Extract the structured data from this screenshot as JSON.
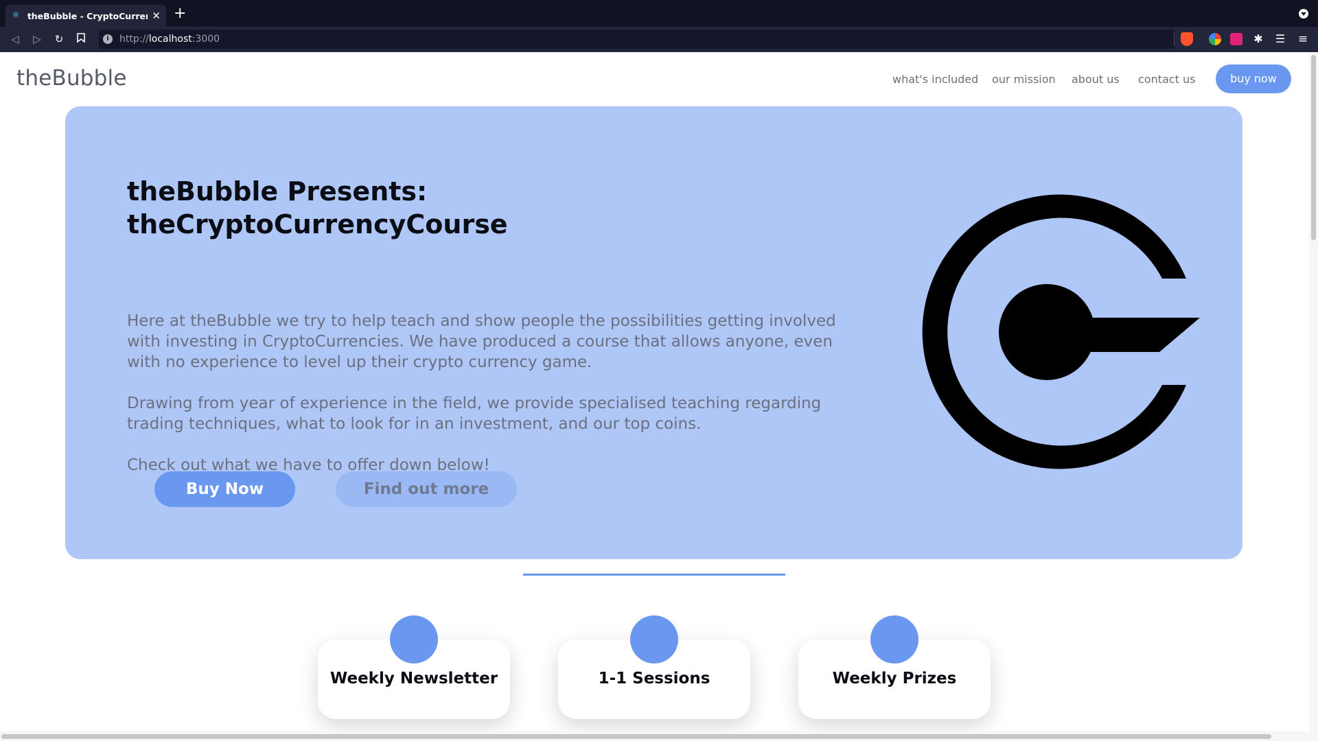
{
  "browser": {
    "tab_title": "theBubble - CryptoCurrency Course",
    "tab_close": "✕",
    "new_tab": "+",
    "url_scheme": "http://",
    "url_host": "localhost",
    "url_port": ":3000",
    "icons": [
      "react-favicon-icon",
      "back-icon",
      "forward-icon",
      "reload-icon",
      "bookmark-icon",
      "info-icon",
      "brave-shield-icon",
      "extension-icon",
      "puzzle-icon",
      "playlist-icon",
      "menu-icon"
    ]
  },
  "header": {
    "logo": "theBubble",
    "nav": [
      "what's included",
      "our mission",
      "about us",
      "contact us"
    ],
    "buy_button": "buy now"
  },
  "hero": {
    "title_line1": "theBubble Presents:",
    "title_line2": "theCryptoCurrencyCourse",
    "paragraph1": "Here at theBubble we try to help teach and show people the possibilities getting involved with investing in CryptoCurrencies. We have produced a course that allows anyone, even with no experience to level up their crypto currency game.",
    "paragraph2": "Drawing from year of experience in the field, we provide specialised teaching regarding trading techniques, what to look for in an investment, and our top coins.",
    "paragraph3": "Check out what we have to offer down below!",
    "primary_button": "Buy Now",
    "secondary_button": "Find out more"
  },
  "features": [
    {
      "label": "Weekly Newsletter"
    },
    {
      "label": "1-1 Sessions"
    },
    {
      "label": "Weekly Prizes"
    }
  ],
  "colors": {
    "accent": "#6a98f0",
    "hero_background": "#afc7f6",
    "tab_bar": "#111322",
    "toolbar": "#23263a"
  }
}
